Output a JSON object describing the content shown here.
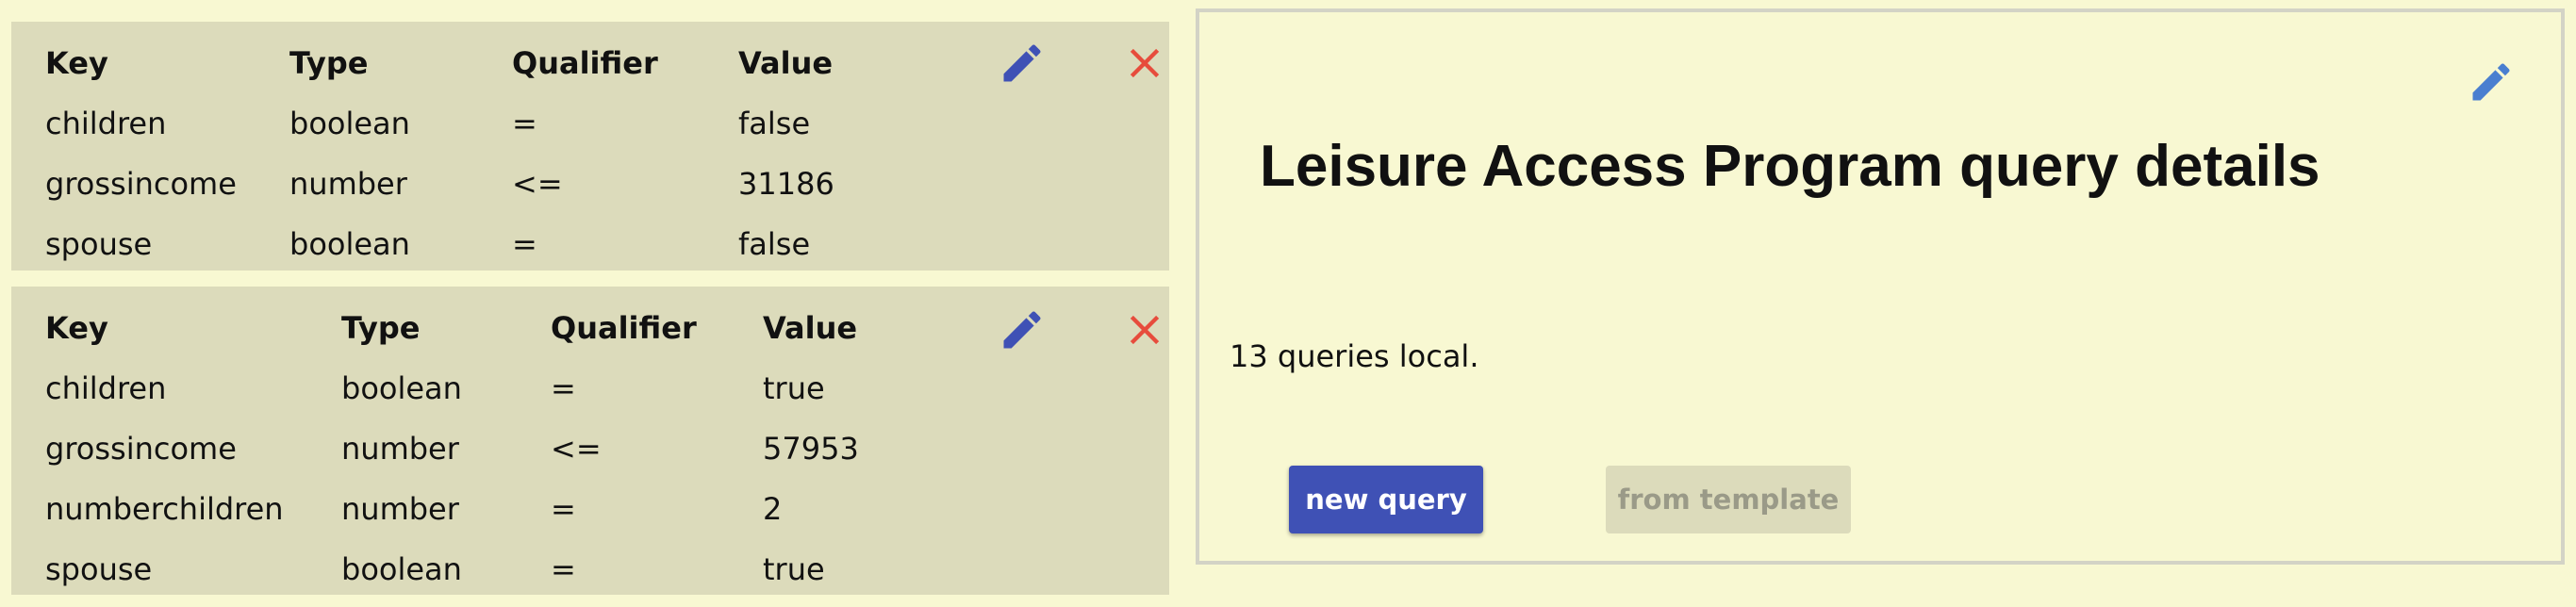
{
  "colors": {
    "page_background": "#f8f8d2",
    "card_background": "#dcdbbb",
    "edit_icon": "#3f51b5",
    "delete_icon": "#e74c3c",
    "primary_button": "#3f51b5",
    "disabled_button_text": "#9a9a88"
  },
  "icons": {
    "edit": "pencil-icon",
    "delete": "close-icon"
  },
  "queries": [
    {
      "headers": {
        "key": "Key",
        "type": "Type",
        "qualifier": "Qualifier",
        "value": "Value"
      },
      "rows": [
        {
          "key": "children",
          "type": "boolean",
          "qualifier": "=",
          "value": "false"
        },
        {
          "key": "grossincome",
          "type": "number",
          "qualifier": "<=",
          "value": "31186"
        },
        {
          "key": "spouse",
          "type": "boolean",
          "qualifier": "=",
          "value": "false"
        }
      ]
    },
    {
      "headers": {
        "key": "Key",
        "type": "Type",
        "qualifier": "Qualifier",
        "value": "Value"
      },
      "rows": [
        {
          "key": "children",
          "type": "boolean",
          "qualifier": "=",
          "value": "true"
        },
        {
          "key": "grossincome",
          "type": "number",
          "qualifier": "<=",
          "value": "57953"
        },
        {
          "key": "numberchildren",
          "type": "number",
          "qualifier": "=",
          "value": "2"
        },
        {
          "key": "spouse",
          "type": "boolean",
          "qualifier": "=",
          "value": "true"
        }
      ]
    }
  ],
  "details": {
    "title": "Leisure Access Program query details",
    "count_text": "13 queries local.",
    "new_query_label": "new query",
    "from_template_label": "from template"
  }
}
